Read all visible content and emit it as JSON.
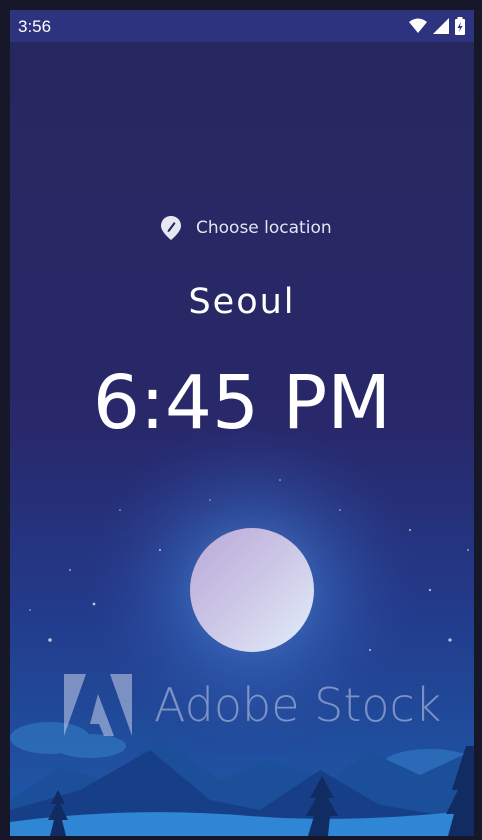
{
  "status_bar": {
    "time": "3:56",
    "icons": [
      "wifi-icon",
      "signal-icon",
      "battery-icon"
    ]
  },
  "location": {
    "label": "Choose location",
    "icon": "location-pin-icon"
  },
  "city": "Seoul",
  "time": "6:45 PM",
  "watermark": {
    "text": "Adobe Stock",
    "logo": "adobe-logo"
  },
  "colors": {
    "status_bar": "#2e3380",
    "sky_top": "#27275e",
    "sky_bottom": "#1f4ea6",
    "text": "#ffffff"
  }
}
